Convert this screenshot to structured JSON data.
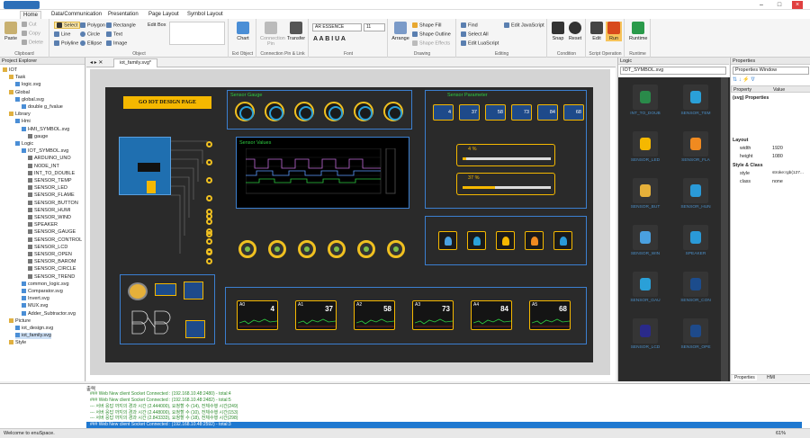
{
  "ribbon_tabs": [
    "Home",
    "Data/Communication",
    "Presentation",
    "Page Layout",
    "Symbol Layout"
  ],
  "clipboard": {
    "paste": "Paste",
    "cut": "Cut",
    "copy": "Copy",
    "delete": "Delete",
    "label": "Clipboard"
  },
  "object": {
    "select": "Select",
    "line": "Line",
    "polyline": "Polyline",
    "polygon": "Polygon",
    "circle": "Circle",
    "ellipse": "Ellipse",
    "rectangle": "Rectangle",
    "text": "Text",
    "image": "Image",
    "editbox": "Edit Box",
    "label": "Object"
  },
  "chart": {
    "chart": "Chart",
    "label": "Ext Object"
  },
  "connection": {
    "point": "Connection Pin",
    "transfer": "Transfer",
    "label": "Connection Pin & Link"
  },
  "font": {
    "name": "AR ESSENCE",
    "size": "11",
    "label": "Font"
  },
  "drawing": {
    "arrange": "Arrange",
    "fill": "Shape Fill",
    "outline": "Shape Outline",
    "effects": "Shape Effects",
    "label": "Drawing"
  },
  "editing": {
    "find": "Find",
    "select_all": "Select All",
    "edit_lua": "Edit LuaScript",
    "edit_js": "Edit JavaScript",
    "label": "Editing"
  },
  "condition": {
    "snap": "Snap",
    "reset": "Reset",
    "label": "Condition"
  },
  "script": {
    "edit": "Edit",
    "run": "Run",
    "label": "Script Operation"
  },
  "runtime": {
    "runtime": "Runtime",
    "label": "Runtime"
  },
  "project_explorer": {
    "title": "Project Explorer",
    "items": [
      {
        "label": "IOT",
        "indent": 0
      },
      {
        "label": "Task",
        "indent": 1
      },
      {
        "label": "logic.svg",
        "indent": 2
      },
      {
        "label": "Global",
        "indent": 1
      },
      {
        "label": "global.svg",
        "indent": 2
      },
      {
        "label": "double g_fvalue",
        "indent": 3
      },
      {
        "label": "Library",
        "indent": 1
      },
      {
        "label": "Hmi",
        "indent": 2
      },
      {
        "label": "HMI_SYMBOL.svg",
        "indent": 3
      },
      {
        "label": "gauge",
        "indent": 4
      },
      {
        "label": "Logic",
        "indent": 2
      },
      {
        "label": "IOT_SYMBOL.svg",
        "indent": 3
      },
      {
        "label": "ARDUINO_UNO",
        "indent": 4
      },
      {
        "label": "NODE_INT",
        "indent": 4
      },
      {
        "label": "INT_TO_DOUBLE",
        "indent": 4
      },
      {
        "label": "SENSOR_TEMP",
        "indent": 4
      },
      {
        "label": "SENSOR_LED",
        "indent": 4
      },
      {
        "label": "SENSOR_FLAME",
        "indent": 4
      },
      {
        "label": "SENSOR_BUTTON",
        "indent": 4
      },
      {
        "label": "SENSOR_HUMI",
        "indent": 4
      },
      {
        "label": "SENSOR_WIND",
        "indent": 4
      },
      {
        "label": "SPEAKER",
        "indent": 4
      },
      {
        "label": "SENSOR_GAUGE",
        "indent": 4
      },
      {
        "label": "SENSOR_CONTROL",
        "indent": 4
      },
      {
        "label": "SENSOR_LCD",
        "indent": 4
      },
      {
        "label": "SENSOR_OPEN",
        "indent": 4
      },
      {
        "label": "SENSOR_BAROM",
        "indent": 4
      },
      {
        "label": "SENSOR_CIRCLE",
        "indent": 4
      },
      {
        "label": "SENSOR_TREND",
        "indent": 4
      },
      {
        "label": "common_logic.svg",
        "indent": 3
      },
      {
        "label": "Comparator.svg",
        "indent": 3
      },
      {
        "label": "Invert.svg",
        "indent": 3
      },
      {
        "label": "MUX.svg",
        "indent": 3
      },
      {
        "label": "Adder_Subtractor.svg",
        "indent": 3
      },
      {
        "label": "Picture",
        "indent": 1
      },
      {
        "label": "iot_design.svg",
        "indent": 2
      },
      {
        "label": "iot_family.svg",
        "indent": 2
      },
      {
        "label": "Style",
        "indent": 1
      }
    ]
  },
  "document": {
    "tab": "iot_family.svg*",
    "page_button": "GO IOT DESIGN PAGE",
    "sensor_gauge": "Sensor Gauge",
    "sensor_parameter": "Sensor Parameter",
    "sensor_values": "Sensor Values",
    "params": [
      "4",
      "37",
      "58",
      "73",
      "84",
      "68"
    ],
    "slider1": {
      "label": "4 %",
      "value": 0.04
    },
    "slider2": {
      "label": "37 %",
      "value": 0.37
    },
    "minis": [
      {
        "label": "A0",
        "value": "4"
      },
      {
        "label": "A1",
        "value": "37"
      },
      {
        "label": "A2",
        "value": "58"
      },
      {
        "label": "A3",
        "value": "73"
      },
      {
        "label": "A4",
        "value": "84"
      },
      {
        "label": "A5",
        "value": "68"
      }
    ]
  },
  "logic_panel": {
    "title": "Logic",
    "file": "IOT_SYMBOL.svg",
    "symbols": [
      "INT_TO_DOUB",
      "SENSOR_TEM",
      "SENSOR_LED",
      "SENSOR_FLA",
      "SENSOR_BUT",
      "SENSOR_HUN",
      "SENSOR_WIN",
      "SPEAKER",
      "SENSOR_GAU",
      "SENSOR_CON",
      "SENSOR_LCD",
      "SENSOR_OPE"
    ]
  },
  "properties": {
    "title": "Properties",
    "window": "Properties Window",
    "col_property": "Property",
    "col_value": "Value",
    "svg_props": "(svg) Properties",
    "layout": "Layout",
    "width_label": "width",
    "width_value": "1920",
    "height_label": "height",
    "height_value": "1080",
    "style_class": "Style & Class",
    "style_label": "style",
    "style_value": "stroke:rgb(127...",
    "class_label": "class",
    "class_value": "none",
    "bottom_tabs": [
      "Properties",
      "HMI"
    ]
  },
  "output": {
    "title": "출력",
    "lines": [
      "### Web New client Socket Connected : (192.168.10.48:2480) - total:4",
      "### Web New client Socket Connected : (192.168.10.48:2482) - total:5",
      "--- 서버 응답 까지의 경과 시간 (2.444000), 요청할 수 (14), 전체수행 시간(249)",
      "--- 서버 응답 까지의 경과 시간 (2.448000), 요청할 수 (10), 전체수행 시간(153)",
      "--- 서버 응답 까지의 경과 시간 (2.843333), 요청할 수 (18), 전체수행 시간(298)"
    ],
    "selected": "### Web New client Socket Connected : (192.168.10.48:2592) - total:3"
  },
  "status": {
    "text": "Welcome to enuSpace.",
    "zoom": "61%"
  }
}
